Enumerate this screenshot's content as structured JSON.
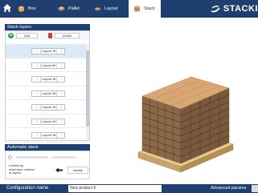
{
  "topbar": {
    "tabs": [
      {
        "label": "Box",
        "icon": "box-icon"
      },
      {
        "label": "Pallet",
        "icon": "pallet-icon"
      },
      {
        "label": "Layout",
        "icon": "layout-icon"
      },
      {
        "label": "Stack",
        "icon": "stack-icon"
      }
    ],
    "active_tab": "Stack",
    "logo_text": "STACKI"
  },
  "stack_layers": {
    "title": "Stack layers",
    "add_label": "Add",
    "delete_label": "Delete",
    "layers": [
      {
        "value": "Layout 1",
        "selected": true
      },
      {
        "value": "Layout 2",
        "selected": false
      },
      {
        "value": "Layout 1",
        "selected": false
      },
      {
        "value": "Layout 2",
        "selected": false
      },
      {
        "value": "Layout 1",
        "selected": false
      },
      {
        "value": "Layout 1",
        "selected": false
      },
      {
        "value": "Layout 1",
        "selected": false
      },
      {
        "value": "Layout 1",
        "selected": false
      }
    ]
  },
  "automatic_stack": {
    "title": "Automatic stack",
    "limited_label": "Limited by maximum number of layers",
    "modify_label": "Modify"
  },
  "bottombar": {
    "config_label": "Configuration name",
    "config_value": "New product 6",
    "advanced_label": "Advanced params"
  },
  "colors": {
    "navy": "#1f3f6e",
    "carton": "#d9a774",
    "carton_dark": "#9a6d45",
    "pallet_wood": "#e7c98f"
  }
}
